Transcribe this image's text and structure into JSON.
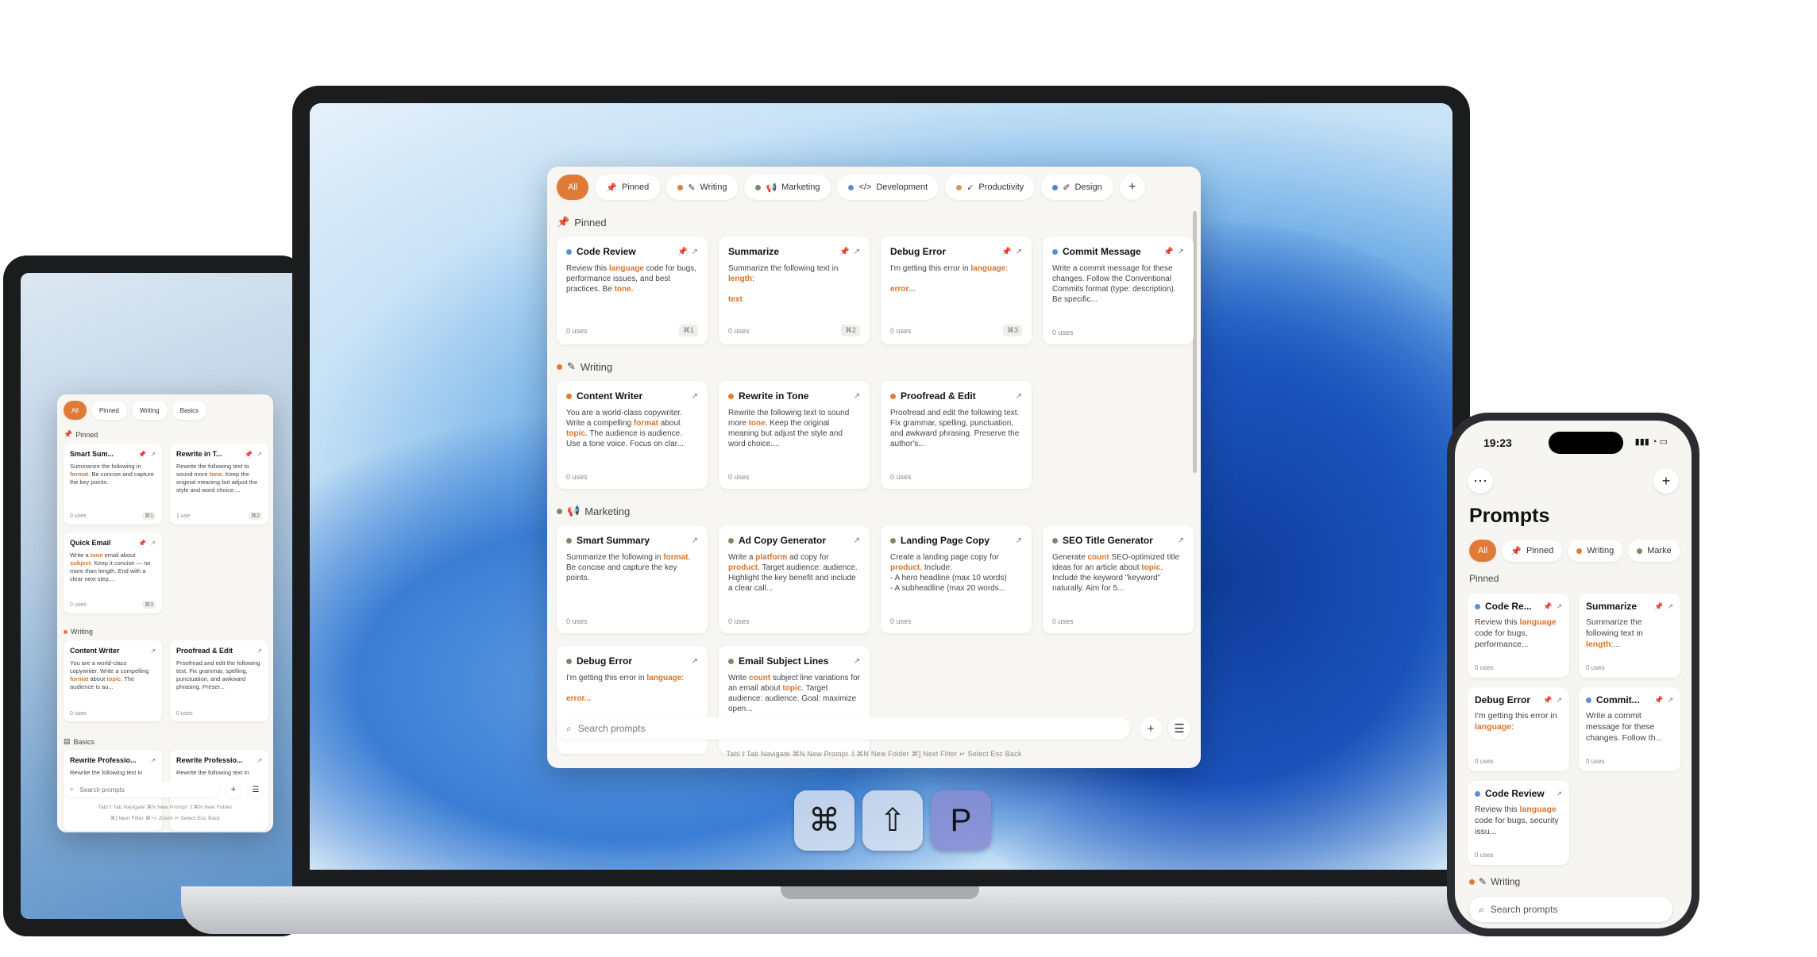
{
  "keys": [
    "⌘",
    "⇧",
    "P"
  ],
  "colors": {
    "accent": "#e07b35",
    "writing": "#e07b35",
    "marketing": "#7c8a6a",
    "development": "#5b8fd0",
    "productivity": "#d59a5f",
    "design": "#5b7fd0"
  },
  "tabs": [
    {
      "label": "All",
      "icon": "",
      "dot": ""
    },
    {
      "label": "Pinned",
      "icon": "pin-icon",
      "dot": ""
    },
    {
      "label": "Writing",
      "icon": "pen-icon",
      "dot": "#e07b35"
    },
    {
      "label": "Marketing",
      "icon": "megaphone-icon",
      "dot": "#7c8a6a"
    },
    {
      "label": "Development",
      "icon": "code-icon",
      "dot": "#5b8fd0"
    },
    {
      "label": "Productivity",
      "icon": "check-circle-icon",
      "dot": "#d59a5f"
    },
    {
      "label": "Design",
      "icon": "brush-icon",
      "dot": "#5b7fd0"
    }
  ],
  "sections": {
    "pinned": "Pinned",
    "writing": "Writing",
    "marketing": "Marketing",
    "basics": "Basics"
  },
  "main": {
    "pinned": [
      {
        "title": "Code Review",
        "dot": "#5b8fd0",
        "pinned": true,
        "body": [
          "Review this ",
          "language",
          " code for bugs, performance issues, and best practices. Be ",
          "tone",
          "."
        ],
        "uses": "0 uses",
        "shortcut": "⌘1"
      },
      {
        "title": "Summarize",
        "dot": "",
        "pinned": true,
        "body": [
          "Summarize the following text in ",
          "length",
          ":\n\n",
          "text",
          ""
        ],
        "uses": "0 uses",
        "shortcut": "⌘2"
      },
      {
        "title": "Debug Error",
        "dot": "",
        "pinned": true,
        "body": [
          "I'm getting this error in ",
          "language",
          ":\n\n",
          "error...",
          ""
        ],
        "uses": "0 uses",
        "shortcut": "⌘3"
      },
      {
        "title": "Commit Message",
        "dot": "#5b8fd0",
        "pinned": true,
        "body": [
          "Write a commit message for these changes. Follow the Conventional Commits format (type: description). Be specific...",
          "",
          "",
          "",
          ""
        ],
        "uses": "0 uses",
        "shortcut": ""
      }
    ],
    "writing": [
      {
        "title": "Content Writer",
        "dot": "#e07b35",
        "body": [
          "You are a world-class copywriter. Write a compelling ",
          "format",
          " about ",
          "topic",
          ". The audience is audience. Use a tone voice. Focus on clar..."
        ],
        "uses": "0 uses"
      },
      {
        "title": "Rewrite in Tone",
        "dot": "#e07b35",
        "body": [
          "Rewrite the following text to sound more ",
          "tone",
          ". Keep the original meaning but adjust the style and word choice....",
          "",
          ""
        ],
        "uses": "0 uses"
      },
      {
        "title": "Proofread & Edit",
        "dot": "#e07b35",
        "body": [
          "Proofread and edit the following text. Fix grammar, spelling, punctuation, and awkward phrasing. Preserve the author's...",
          "",
          "",
          "",
          ""
        ],
        "uses": "0 uses"
      }
    ],
    "marketing": [
      {
        "title": "Smart Summary",
        "dot": "#7c8a6a",
        "body": [
          "Summarize the following in ",
          "format",
          ". Be concise and capture the key points.",
          "",
          ""
        ],
        "uses": "0 uses"
      },
      {
        "title": "Ad Copy Generator",
        "dot": "#7c8a6a",
        "body": [
          "Write a ",
          "platform",
          " ad copy for ",
          "product",
          ". Target audience: audience. Highlight the key benefit and include a clear call..."
        ],
        "uses": "0 uses"
      },
      {
        "title": "Landing Page Copy",
        "dot": "#7c8a6a",
        "body": [
          "Create a landing page copy for ",
          "product",
          ". Include:\n- A hero headline (max 10 words)\n- A subheadline (max 20 words...",
          "",
          ""
        ],
        "uses": "0 uses"
      },
      {
        "title": "SEO Title Generator",
        "dot": "#7c8a6a",
        "body": [
          "Generate ",
          "count",
          " SEO-optimized title ideas for an article about ",
          "topic",
          ". Include the keyword \"keyword\" naturally. Aim for 5..."
        ],
        "uses": "0 uses"
      },
      {
        "title": "Debug Error",
        "dot": "#7c8a6a",
        "body": [
          "I'm getting this error in ",
          "language",
          ":\n\n",
          "error...",
          ""
        ],
        "uses": ""
      },
      {
        "title": "Email Subject Lines",
        "dot": "#7c8a6a",
        "body": [
          "Write ",
          "count",
          " subject line variations for an email about ",
          "topic",
          ". Target audience: audience. Goal: maximize open..."
        ],
        "uses": ""
      }
    ],
    "search_placeholder": "Search prompts",
    "hints": "Tab/⇧Tab  Navigate     ⌘N  New Prompt     ⇧⌘N  New Folder     ⌘]  Next Filter     ↵  Select     Esc  Back"
  },
  "tablet": {
    "tabs": [
      "All",
      "Pinned",
      "Writing",
      "Basics"
    ],
    "pinned": [
      {
        "title": "Smart Sum...",
        "body": [
          "Summarize the following in ",
          "format",
          ". Be concise and capture the key points.",
          "",
          ""
        ],
        "uses": "0 uses",
        "shortcut": "⌘1"
      },
      {
        "title": "Rewrite in T...",
        "body": [
          "Rewrite the following text to sound more ",
          "tone",
          ". Keep the original meaning but adjust the style and word choice....",
          "",
          ""
        ],
        "uses": "1 use",
        "shortcut": "⌘2"
      },
      {
        "title": "Quick Email",
        "body": [
          "Write a ",
          "tone",
          " email about ",
          "subject",
          ". Keep it concise — no more than length. End with a clear next step...."
        ],
        "uses": "0 uses",
        "shortcut": "⌘3"
      }
    ],
    "writing": [
      {
        "title": "Content Writer",
        "body": [
          "You are a world-class copywriter. Write a compelling ",
          "format",
          " about ",
          "topic",
          ". The audience is au..."
        ],
        "uses": "0 uses"
      },
      {
        "title": "Proofread & Edit",
        "body": [
          "Proofread and edit the following text. Fix grammar, spelling, punctuation, and awkward phrasing. Preser...",
          "",
          "",
          "",
          ""
        ],
        "uses": "0 uses"
      }
    ],
    "basics": [
      {
        "title": "Rewrite Professio...",
        "body": [
          "Rewrite the following text in",
          "",
          "",
          "",
          ""
        ]
      },
      {
        "title": "Rewrite Professio...",
        "body": [
          "Rewrite the following text in",
          "",
          "",
          "",
          ""
        ]
      }
    ],
    "search_placeholder": "Search prompts",
    "hints1": "Tab/⇧Tab  Navigate   ⌘N  New Prompt   ⇧⌘N  New Folder",
    "hints2": "⌘]  Next Filter   ⌘+/-  Zoom   ↵  Select   Esc  Back"
  },
  "phone": {
    "time": "19:23",
    "title": "Prompts",
    "tabs": [
      "All",
      "Pinned",
      "Writing",
      "Marke"
    ],
    "pinned_label": "Pinned",
    "writing_label": "Writing",
    "cards": [
      {
        "title": "Code Re...",
        "dot": "#5b8fd0",
        "body": [
          "Review this ",
          "language",
          " code for bugs, performance...",
          "",
          ""
        ],
        "uses": "0 uses"
      },
      {
        "title": "Summarize",
        "dot": "",
        "body": [
          "Summarize the following text in ",
          "length",
          ":...",
          "",
          ""
        ],
        "uses": "0 uses"
      },
      {
        "title": "Debug Error",
        "dot": "",
        "body": [
          "I'm getting this error in ",
          "language",
          ":",
          "",
          ""
        ],
        "uses": "0 uses"
      },
      {
        "title": "Commit...",
        "dot": "#5b8fd0",
        "body": [
          "Write a commit message for these changes. Follow th...",
          "",
          "",
          "",
          ""
        ],
        "uses": "0 uses"
      },
      {
        "title": "Code Review",
        "dot": "#5b8fd0",
        "body": [
          "Review this ",
          "language",
          " code for bugs, security issu...",
          "",
          ""
        ],
        "uses": "0 uses"
      }
    ],
    "search_placeholder": "Search prompts"
  }
}
